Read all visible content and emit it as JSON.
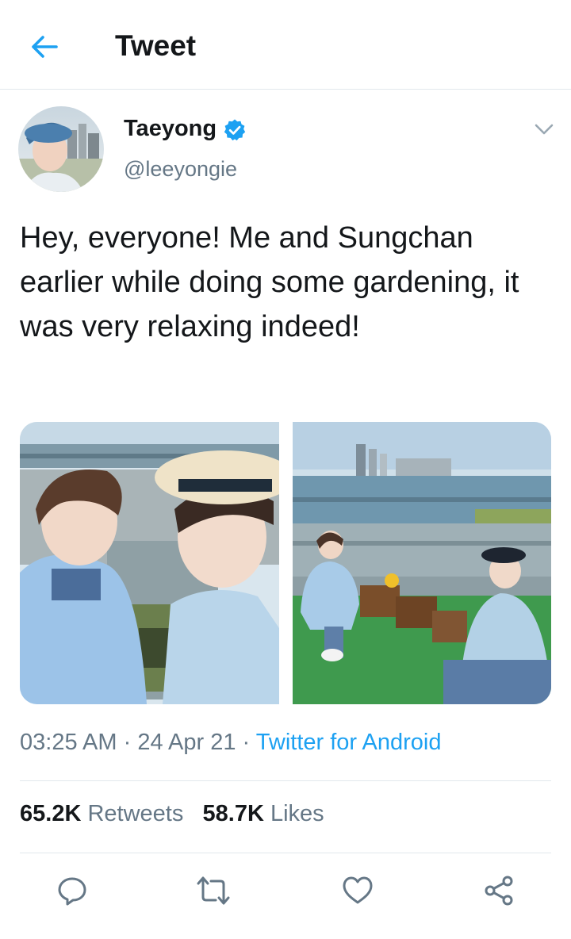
{
  "header": {
    "title": "Tweet",
    "back_icon": "arrow-left-icon"
  },
  "author": {
    "name": "Taeyong",
    "handle": "@leeyongie",
    "verified": true,
    "menu_icon": "chevron-down-icon"
  },
  "tweet": {
    "text": "Hey, everyone! Me and Sungchan earlier while doing some gardening, it was very relaxing indeed!",
    "media_count": 2
  },
  "meta": {
    "time": "03:25 AM",
    "separator": "·",
    "date": "24 Apr 21",
    "source": "Twitter for Android"
  },
  "stats": {
    "retweets_count": "65.2K",
    "retweets_label": "Retweets",
    "likes_count": "58.7K",
    "likes_label": "Likes"
  },
  "actions": [
    {
      "name": "reply",
      "icon": "comment-icon"
    },
    {
      "name": "retweet",
      "icon": "retweet-icon"
    },
    {
      "name": "like",
      "icon": "heart-icon"
    },
    {
      "name": "share",
      "icon": "share-icon"
    }
  ],
  "colors": {
    "accent": "#1da1f2",
    "text": "#14171a",
    "secondary": "#657786",
    "divider": "#e1e8ed"
  }
}
